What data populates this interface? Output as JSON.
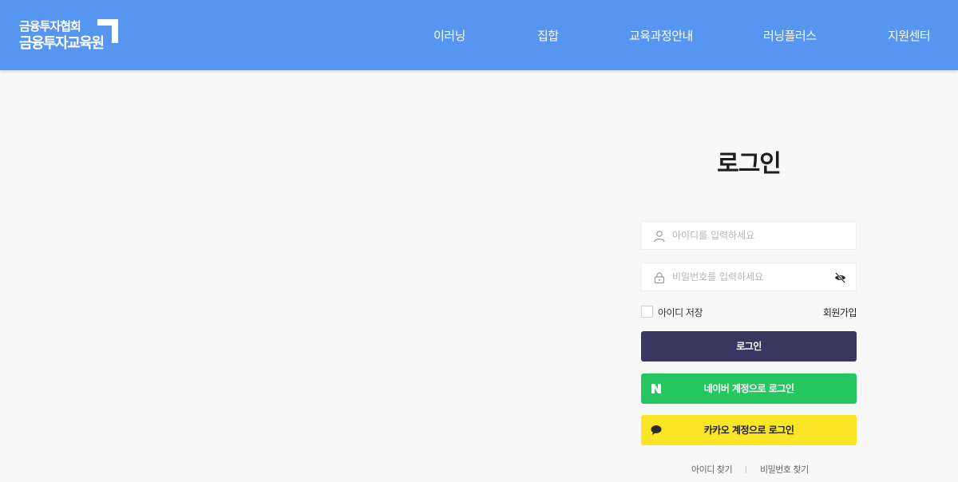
{
  "header": {
    "logo": {
      "line1": "금융투자협회",
      "line2": "금융투자교육원"
    },
    "nav": [
      "이러닝",
      "집합",
      "교육과정안내",
      "러닝플러스",
      "지원센터"
    ]
  },
  "login": {
    "title": "로그인",
    "id_placeholder": "아이디를 입력하세요",
    "pw_placeholder": "비밀번호를 입력하세요",
    "save_id_label": "아이디 저장",
    "signup_label": "회원가입",
    "login_button": "로그인",
    "naver_button": "네이버 계정으로 로그인",
    "kakao_button": "카카오 계정으로 로그인",
    "find_id": "아이디 찾기",
    "find_pw": "비밀번호 찾기"
  },
  "colors": {
    "header_bg": "#5695f0",
    "login_button": "#393760",
    "naver_green": "#25c860",
    "kakao_yellow": "#fae526"
  },
  "icons": {
    "id_field": "user-icon",
    "pw_field": "lock-icon",
    "pw_toggle": "eye-slash-icon",
    "naver": "naver-n-icon",
    "kakao": "chat-bubble-icon"
  }
}
